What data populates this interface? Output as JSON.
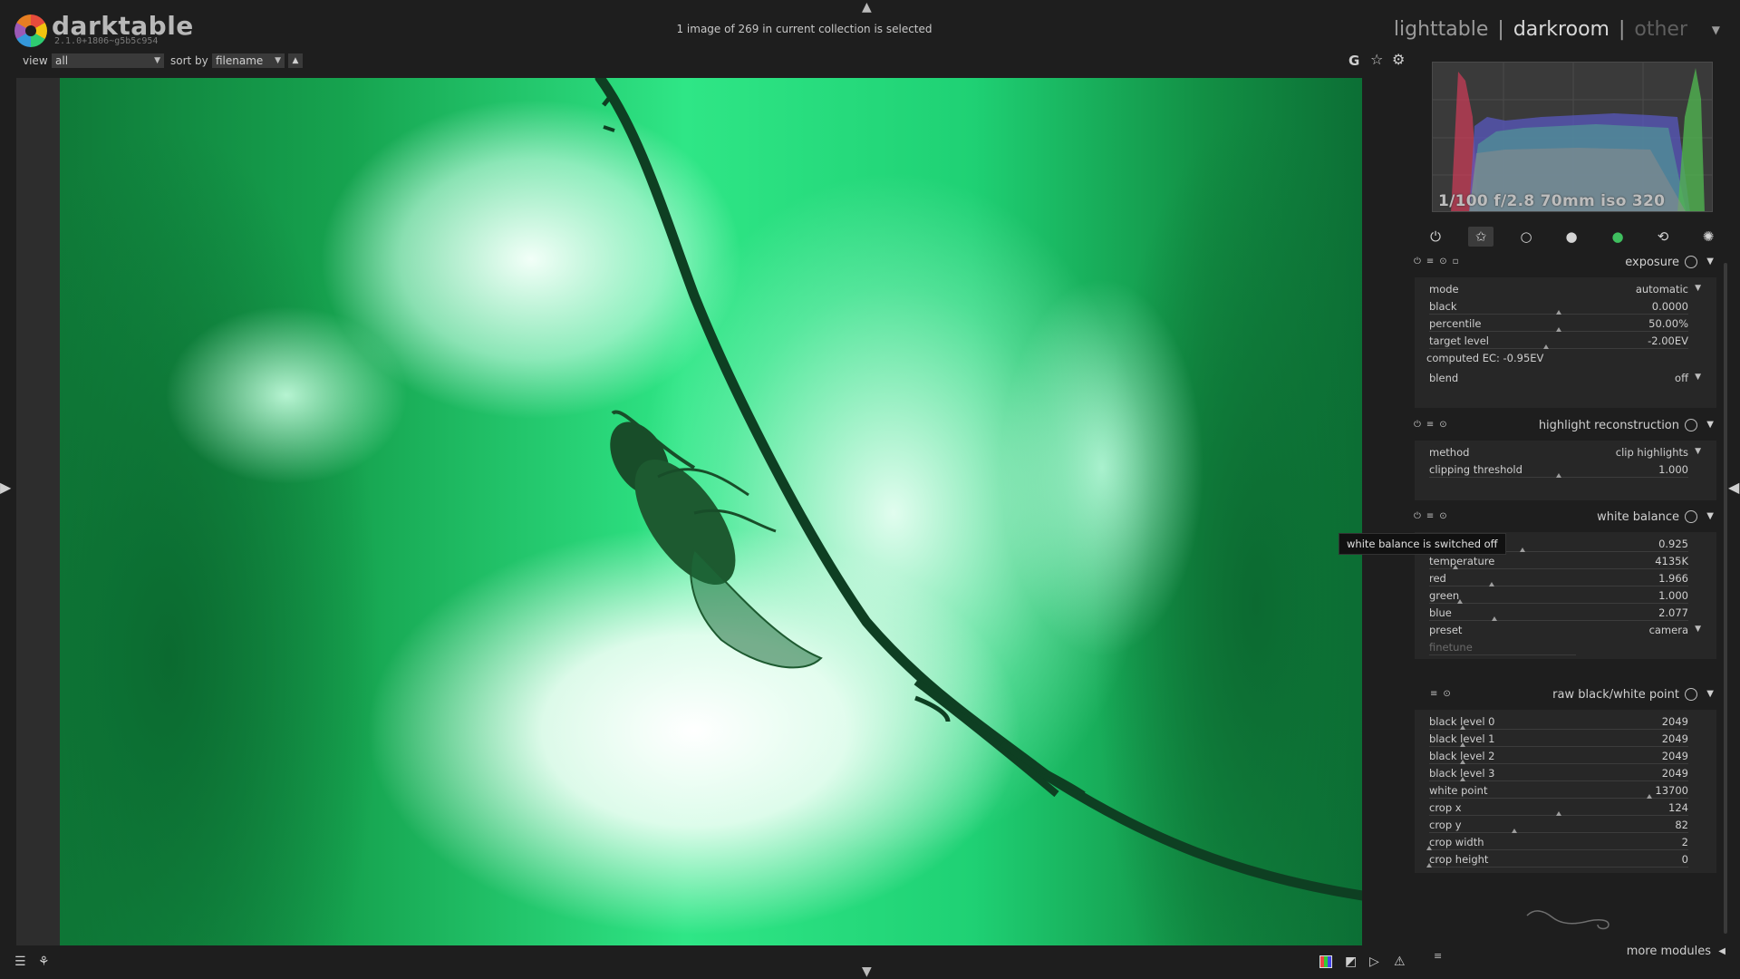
{
  "app": {
    "name": "darktable",
    "version": "2.1.0+1806~g5b5c954"
  },
  "status": "1 image of 269 in current collection is selected",
  "views": {
    "lighttable": "lighttable",
    "darkroom": "darkroom",
    "other": "other",
    "separator": "|"
  },
  "filter": {
    "view_label": "view",
    "view_value": "all",
    "sort_label": "sort by",
    "sort_value": "filename"
  },
  "toolbar_icons": [
    "guides-icon",
    "star-icon",
    "gear-icon"
  ],
  "toolbar_text": {
    "guides": "G",
    "star": "☆",
    "gear": "⚙"
  },
  "histogram": {
    "exif": "1/100 f/2.8 70mm iso 320"
  },
  "module_groups": [
    "power-icon",
    "favorite-icon",
    "basic-circle-icon",
    "tone-icon",
    "color-icon",
    "correct-icon",
    "effect-icon"
  ],
  "modules": {
    "exposure": {
      "title": "exposure",
      "mode": {
        "label": "mode",
        "value": "automatic"
      },
      "black": {
        "label": "black",
        "value": "0.0000",
        "pos": 0.5
      },
      "percentile": {
        "label": "percentile",
        "value": "50.00%",
        "pos": 0.5
      },
      "target_level": {
        "label": "target level",
        "value": "-2.00EV",
        "pos": 0.45
      },
      "computed": "computed EC: -0.95EV",
      "blend": {
        "label": "blend",
        "value": "off"
      }
    },
    "highlight": {
      "title": "highlight reconstruction",
      "method": {
        "label": "method",
        "value": "clip highlights"
      },
      "clipping": {
        "label": "clipping threshold",
        "value": "1.000",
        "pos": 0.5
      }
    },
    "white_balance": {
      "title": "white balance",
      "tint": {
        "label": "",
        "value": "0.925",
        "pos": 0.36
      },
      "temperature": {
        "label": "temperature",
        "value": "4135K",
        "pos": 0.1
      },
      "red": {
        "label": "red",
        "value": "1.966",
        "pos": 0.24
      },
      "green": {
        "label": "green",
        "value": "1.000",
        "pos": 0.12
      },
      "blue": {
        "label": "blue",
        "value": "2.077",
        "pos": 0.25
      },
      "preset": {
        "label": "preset",
        "value": "camera"
      },
      "finetune": {
        "label": "finetune"
      }
    },
    "rawbw": {
      "title": "raw black/white point",
      "rows": [
        {
          "label": "black level 0",
          "value": "2049",
          "pos": 0.13
        },
        {
          "label": "black level 1",
          "value": "2049",
          "pos": 0.13
        },
        {
          "label": "black level 2",
          "value": "2049",
          "pos": 0.13
        },
        {
          "label": "black level 3",
          "value": "2049",
          "pos": 0.13
        },
        {
          "label": "white point",
          "value": "13700",
          "pos": 0.85
        },
        {
          "label": "crop x",
          "value": "124",
          "pos": 0.5
        },
        {
          "label": "crop y",
          "value": "82",
          "pos": 0.33
        },
        {
          "label": "crop width",
          "value": "2",
          "pos": 0.0
        },
        {
          "label": "crop height",
          "value": "0",
          "pos": 0.0
        }
      ]
    }
  },
  "tooltip": "white balance is switched off",
  "more_modules": "more modules",
  "colors": {
    "bg": "#1e1e1e",
    "panel": "#272727",
    "text": "#cfcfcf"
  }
}
